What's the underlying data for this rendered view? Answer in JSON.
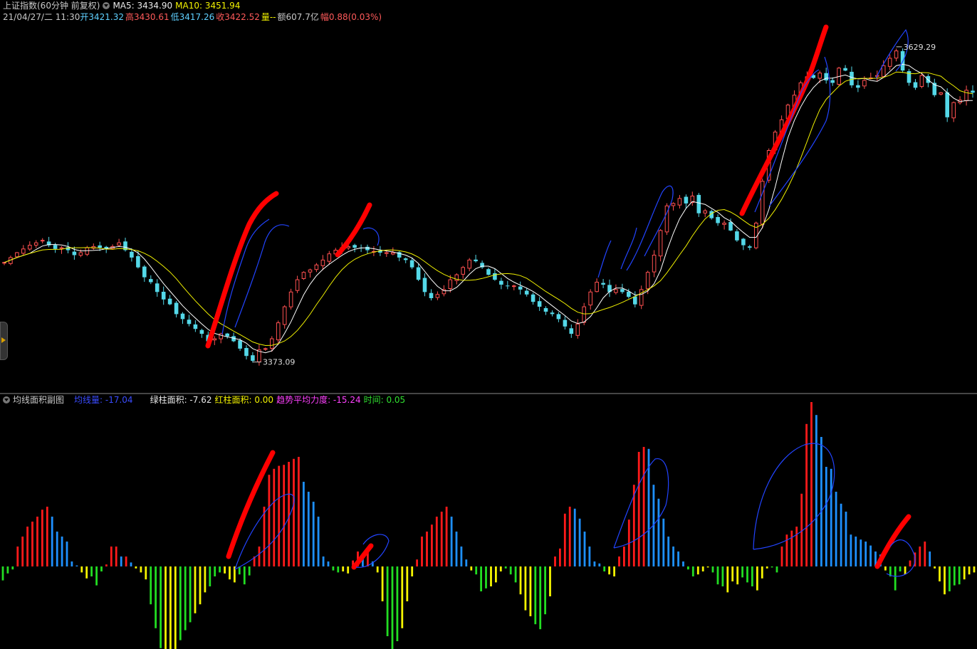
{
  "main_header": {
    "title": "上证指数(60分钟 前复权)",
    "ma5_label": "MA5: 3434.90",
    "ma10_label": "MA10: 3451.94",
    "date": "21/04/27/二 11:30",
    "open": "开3421.32",
    "high": "高3430.61",
    "low": "低3417.26",
    "close": "收3422.52",
    "volume": "量--",
    "amount": "额607.7亿",
    "change": "幅0.88(0.03%)"
  },
  "sub_header": {
    "title": "均线面积副图",
    "avg_line": "均线量: -17.04",
    "green_area": "绿柱面积: -7.62",
    "red_area": "红柱面积: 0.00",
    "trend": "趋势平均力度: -15.24",
    "time": "时间: 0.05"
  },
  "colors": {
    "up": "#ff5050",
    "down": "#54d8e8",
    "ma5": "#ffffff",
    "ma10": "#f0f000",
    "hist_red": "#ff1a1a",
    "hist_blue": "#1e90ff",
    "hist_yellow": "#f5f500",
    "hist_green": "#22dd22",
    "annotation_red": "#ff0000",
    "annotation_blue": "#2244ff"
  },
  "chart_data": [
    {
      "type": "candlestick",
      "title": "上证指数(60分钟 前复权)",
      "ylim": [
        3355,
        3650
      ],
      "annotations": [
        {
          "text": "3629.29",
          "kind": "high_marker",
          "value": 3629.29
        },
        {
          "text": "3373.09",
          "kind": "low_marker",
          "value": 3373.09
        }
      ],
      "series": [
        {
          "name": "MA5"
        },
        {
          "name": "MA10"
        }
      ],
      "trend_path": [
        3454,
        3458,
        3462,
        3465,
        3468,
        3470,
        3472,
        3468,
        3465,
        3466,
        3464,
        3460,
        3462,
        3466,
        3467,
        3466,
        3465,
        3467,
        3470,
        3464,
        3458,
        3450,
        3442,
        3438,
        3430,
        3424,
        3420,
        3412,
        3408,
        3404,
        3400,
        3396,
        3390,
        3392,
        3396,
        3394,
        3390,
        3384,
        3378,
        3374,
        3383,
        3384,
        3392,
        3405,
        3418,
        3430,
        3440,
        3446,
        3448,
        3452,
        3456,
        3461,
        3464,
        3466,
        3467,
        3466,
        3466,
        3464,
        3463,
        3462,
        3462,
        3462,
        3458,
        3456,
        3450,
        3440,
        3430,
        3425,
        3428,
        3432,
        3440,
        3444,
        3450,
        3456,
        3455,
        3450,
        3444,
        3440,
        3436,
        3435,
        3435,
        3432,
        3428,
        3422,
        3418,
        3414,
        3412,
        3408,
        3402,
        3396,
        3404,
        3418,
        3430,
        3438,
        3436,
        3430,
        3432,
        3430,
        3426,
        3420,
        3432,
        3446,
        3460,
        3480,
        3500,
        3502,
        3506,
        3502,
        3508,
        3494,
        3496,
        3490,
        3486,
        3486,
        3480,
        3472,
        3468,
        3466,
        3486,
        3520,
        3545,
        3560,
        3570,
        3582,
        3590,
        3600,
        3605,
        3604,
        3608,
        3602,
        3600,
        3612,
        3610,
        3598,
        3596,
        3602,
        3604,
        3606,
        3614,
        3620,
        3626,
        3610,
        3600,
        3596,
        3606,
        3600,
        3590,
        3592,
        3572,
        3584,
        3586,
        3594,
        3592
      ]
    },
    {
      "type": "bar",
      "title": "均线面积副图",
      "ylim": [
        -1.0,
        1.0
      ],
      "series": [
        {
          "name": "均线量",
          "values": [
            -17.04
          ]
        },
        {
          "name": "绿柱面积",
          "values": [
            -7.62
          ]
        },
        {
          "name": "红柱面积",
          "values": [
            0.0
          ]
        },
        {
          "name": "趋势平均力度",
          "values": [
            -15.24
          ]
        },
        {
          "name": "时间",
          "values": [
            0.05
          ]
        }
      ],
      "values": [
        -0.14,
        -0.07,
        -0.03,
        0.2,
        0.3,
        0.4,
        0.45,
        0.5,
        0.57,
        0.6,
        0.5,
        0.35,
        0.3,
        0.25,
        0.05,
        0.01,
        -0.06,
        -0.12,
        -0.1,
        -0.19,
        -0.05,
        0.02,
        0.2,
        0.2,
        0.1,
        0.1,
        0.04,
        -0.02,
        -0.06,
        -0.13,
        -0.38,
        -0.62,
        -0.82,
        -0.92,
        -1.0,
        -0.9,
        -0.74,
        -0.64,
        -0.56,
        -0.47,
        -0.38,
        -0.26,
        -0.2,
        -0.1,
        -0.06,
        -0.07,
        -0.13,
        -0.16,
        -0.08,
        -0.18,
        -0.09,
        0.1,
        0.2,
        0.6,
        0.92,
        0.98,
        1.01,
        1.02,
        1.05,
        1.08,
        1.1,
        0.85,
        0.75,
        0.65,
        0.5,
        0.1,
        0.05,
        -0.04,
        -0.06,
        -0.05,
        -0.07,
        0.06,
        0.15,
        0.1,
        0.15,
        0.05,
        -0.06,
        -0.35,
        -0.7,
        -0.83,
        -0.75,
        -0.62,
        -0.35,
        -0.1,
        0.07,
        0.3,
        0.35,
        0.42,
        0.5,
        0.55,
        0.6,
        0.5,
        0.35,
        0.2,
        0.07,
        -0.04,
        -0.08,
        -0.25,
        -0.22,
        -0.2,
        -0.16,
        -0.05,
        -0.02,
        -0.08,
        -0.16,
        -0.28,
        -0.44,
        -0.5,
        -0.58,
        -0.63,
        -0.48,
        -0.3,
        0.1,
        0.18,
        0.53,
        0.6,
        0.58,
        0.48,
        0.35,
        0.2,
        0.05,
        0.03,
        -0.05,
        -0.08,
        -0.1,
        0.1,
        0.2,
        0.47,
        0.82,
        1.15,
        1.2,
        1.18,
        0.82,
        0.68,
        0.48,
        0.3,
        0.2,
        0.15,
        0.05,
        -0.03,
        -0.1,
        -0.08,
        -0.05,
        -0.01,
        -0.06,
        -0.18,
        -0.2,
        -0.26,
        -0.15,
        -0.18,
        -0.11,
        -0.16,
        -0.2,
        -0.24,
        -0.12,
        -0.02,
        -0.01,
        -0.06,
        0.2,
        0.32,
        0.36,
        0.4,
        0.73,
        1.43,
        1.65,
        1.52,
        1.3,
        1.0,
        0.98,
        0.75,
        0.63,
        0.55,
        0.32,
        0.3,
        0.27,
        0.25,
        0.21,
        0.15,
        0.12,
        -0.04,
        -0.1,
        -0.24,
        -0.05,
        -0.08,
        0.06,
        0.14,
        0.2,
        0.25,
        0.15,
        -0.02,
        -0.15,
        -0.28,
        -0.25,
        -0.19,
        -0.18,
        -0.13,
        -0.08,
        -0.06
      ]
    }
  ]
}
